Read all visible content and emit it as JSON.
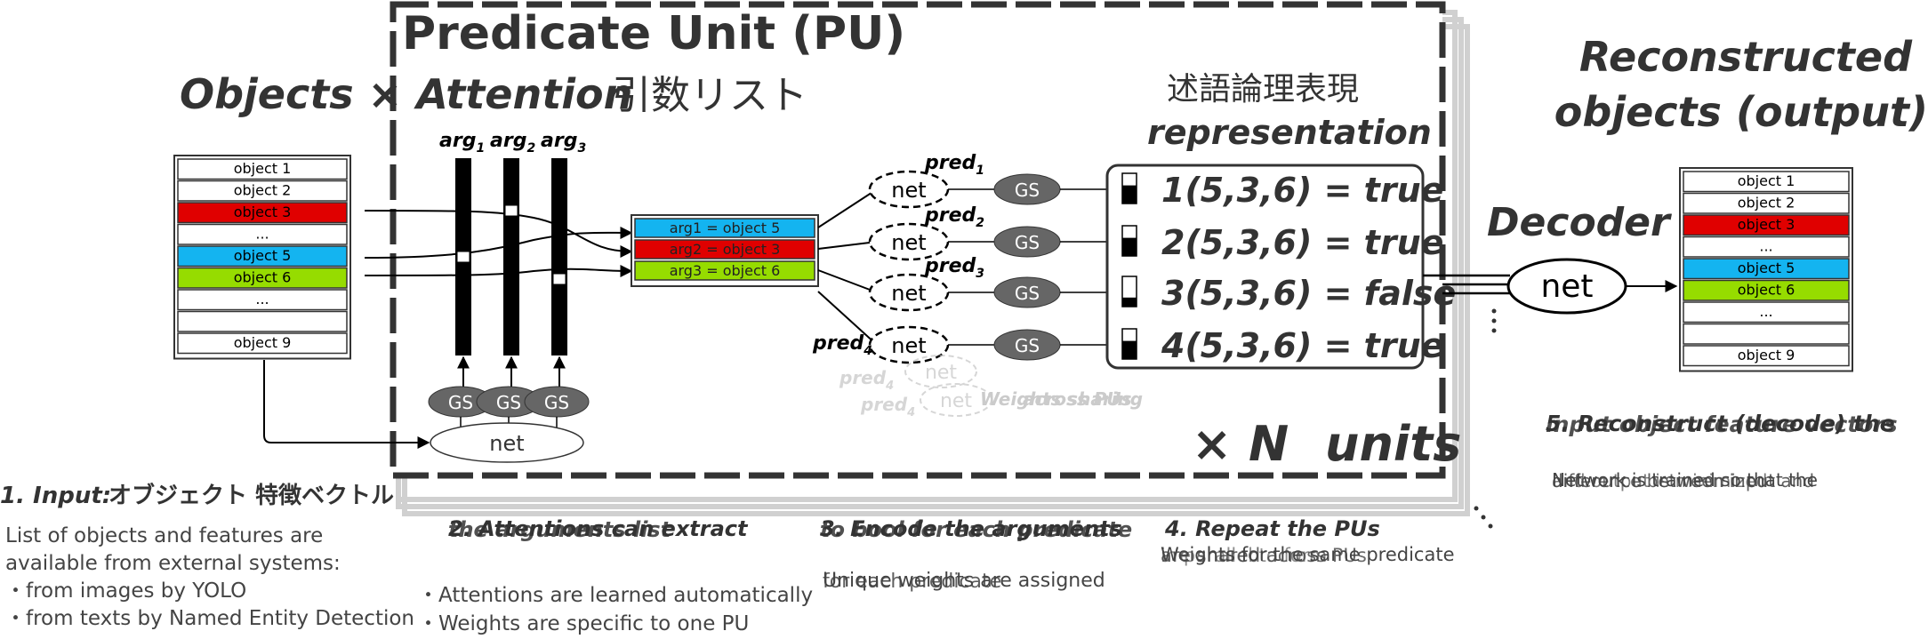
{
  "pu": {
    "title": "Predicate Unit (PU)",
    "x_n": "× N",
    "units": "units"
  },
  "header": {
    "objects_attention": "Objects × Attention",
    "args_list_jp": "引数リスト",
    "logic_jp": "述語論理表現",
    "representation": "representation",
    "reconstructed_line1": "Reconstructed",
    "reconstructed_line2": "objects (output)",
    "decoder": "Decoder"
  },
  "input_objects": [
    {
      "label": "object 1",
      "color": "#ffffff"
    },
    {
      "label": "object 2",
      "color": "#ffffff"
    },
    {
      "label": "object 3",
      "color": "#e00000"
    },
    {
      "label": "...",
      "color": "#ffffff"
    },
    {
      "label": "object 5",
      "color": "#14b4f0"
    },
    {
      "label": "object 6",
      "color": "#96dc00"
    },
    {
      "label": "...",
      "color": "#ffffff"
    },
    {
      "label": "",
      "color": "#ffffff"
    },
    {
      "label": "object 9",
      "color": "#ffffff"
    }
  ],
  "output_objects": [
    {
      "label": "object 1",
      "color": "#ffffff"
    },
    {
      "label": "object 2",
      "color": "#ffffff"
    },
    {
      "label": "object 3",
      "color": "#e00000"
    },
    {
      "label": "...",
      "color": "#ffffff"
    },
    {
      "label": "object 5",
      "color": "#14b4f0"
    },
    {
      "label": "object 6",
      "color": "#96dc00"
    },
    {
      "label": "...",
      "color": "#ffffff"
    },
    {
      "label": "",
      "color": "#ffffff"
    },
    {
      "label": "object 9",
      "color": "#ffffff"
    }
  ],
  "attention_args": [
    "arg",
    "arg",
    "arg"
  ],
  "attention_subs": [
    "1",
    "2",
    "3"
  ],
  "gs_label": "GS",
  "net_label": "net",
  "arg_assignments": [
    {
      "label": "arg1 = object 5",
      "color": "#14b4f0"
    },
    {
      "label": "arg2 = object 3",
      "color": "#e00000"
    },
    {
      "label": "arg3 = object 6",
      "color": "#96dc00"
    }
  ],
  "predicates": [
    {
      "name": "pred",
      "sub": "1",
      "expr": "1(5,3,6) = true",
      "fill": 0.6
    },
    {
      "name": "pred",
      "sub": "2",
      "expr": "2(5,3,6) = true",
      "fill": 0.6
    },
    {
      "name": "pred",
      "sub": "3",
      "expr": "3(5,3,6) = false",
      "fill": 0.3
    },
    {
      "name": "pred",
      "sub": "4",
      "expr": "4(5,3,6) = true",
      "fill": 0.6
    }
  ],
  "ghost": {
    "pred": "pred",
    "sub": "4",
    "weights_sharing": "Weights sharing",
    "across_pus": "across PUs"
  },
  "decoder_net": "net",
  "steps": {
    "s1_title_a": "1. Input:",
    "s1_title_b": "オブジェクト 特徴ベクトル",
    "s1_lines": [
      "List of objects and features are",
      "available from external systems:",
      "・from images by YOLO",
      "・from texts by Named Entity Detection"
    ],
    "s2_title_a": "2. Attentions can extract",
    "s2_title_b": "the arguments list",
    "s2_lines": [
      "・Attentions are learned automatically",
      "・Weights are specific to one PU"
    ],
    "s3_title_a": "3. Encode the arguments",
    "s3_title_b": "to bool for each predicate",
    "s3_line_a": "Unique weights are assigned",
    "s3_line_b": "for each predicate",
    "s4_title": "4. Repeat the PUs",
    "s4_line_a": "Weights for the same predicate",
    "s4_line_b": "are shared across PUs",
    "s4_line_c": "in parallel to form",
    "s5_title_a": "5. Reconstruct (decode) the",
    "s5_title_b": "input object feature vectors",
    "s5_line_a": "Network is trained so that the",
    "s5_line_b": "difference between input and",
    "s5_line_c": "and output is minimized"
  }
}
